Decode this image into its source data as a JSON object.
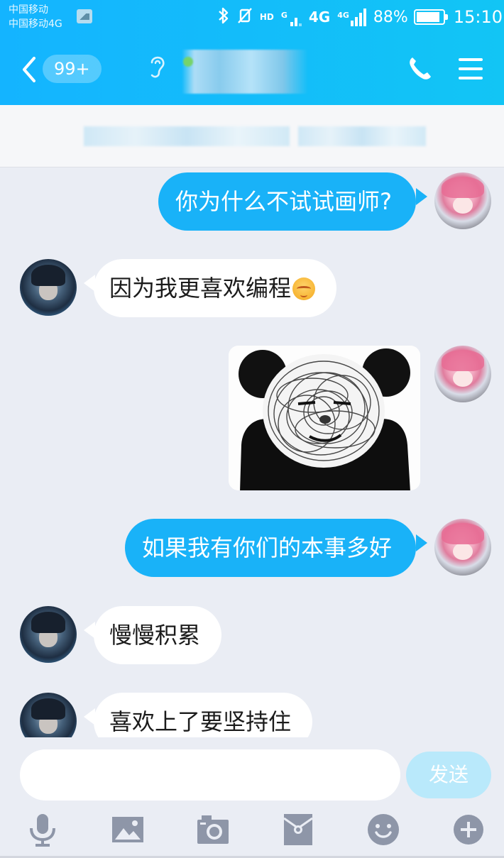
{
  "status_bar": {
    "carrier_1": "中国移动",
    "carrier_2": "中国移动4G",
    "network_1": "HD",
    "network_2": "4G",
    "network_2_sup": "4G",
    "network_3_sup": "G",
    "battery_percent": "88%",
    "battery_level": 0.88,
    "time": "15:10"
  },
  "title_bar": {
    "unread_count": "99+",
    "contact_name": ""
  },
  "messages": [
    {
      "sender": "me",
      "type": "text",
      "text": "你为什么不试试画师?"
    },
    {
      "sender": "other",
      "type": "text",
      "text": "因为我更喜欢编程",
      "emoji": "blushing-emoji"
    },
    {
      "sender": "me",
      "type": "sticker",
      "icon": "panda-face-sticker"
    },
    {
      "sender": "me",
      "type": "text",
      "text": "如果我有你们的本事多好"
    },
    {
      "sender": "other",
      "type": "text",
      "text": "慢慢积累"
    },
    {
      "sender": "other",
      "type": "text",
      "text": "喜欢上了要坚持住"
    }
  ],
  "input": {
    "value": "",
    "send_label": "发送"
  },
  "toolbar": {
    "items": [
      "microphone-icon",
      "image-icon",
      "camera-icon",
      "red-packet-icon",
      "emoji-icon",
      "plus-icon"
    ]
  },
  "colors": {
    "header": "#14b4ff",
    "bubble_me": "#19b2f8",
    "bubble_other": "#ffffff",
    "background": "#eaedf4",
    "send_disabled": "#b9e9fb",
    "toolbar_icon": "#8e96a8"
  }
}
